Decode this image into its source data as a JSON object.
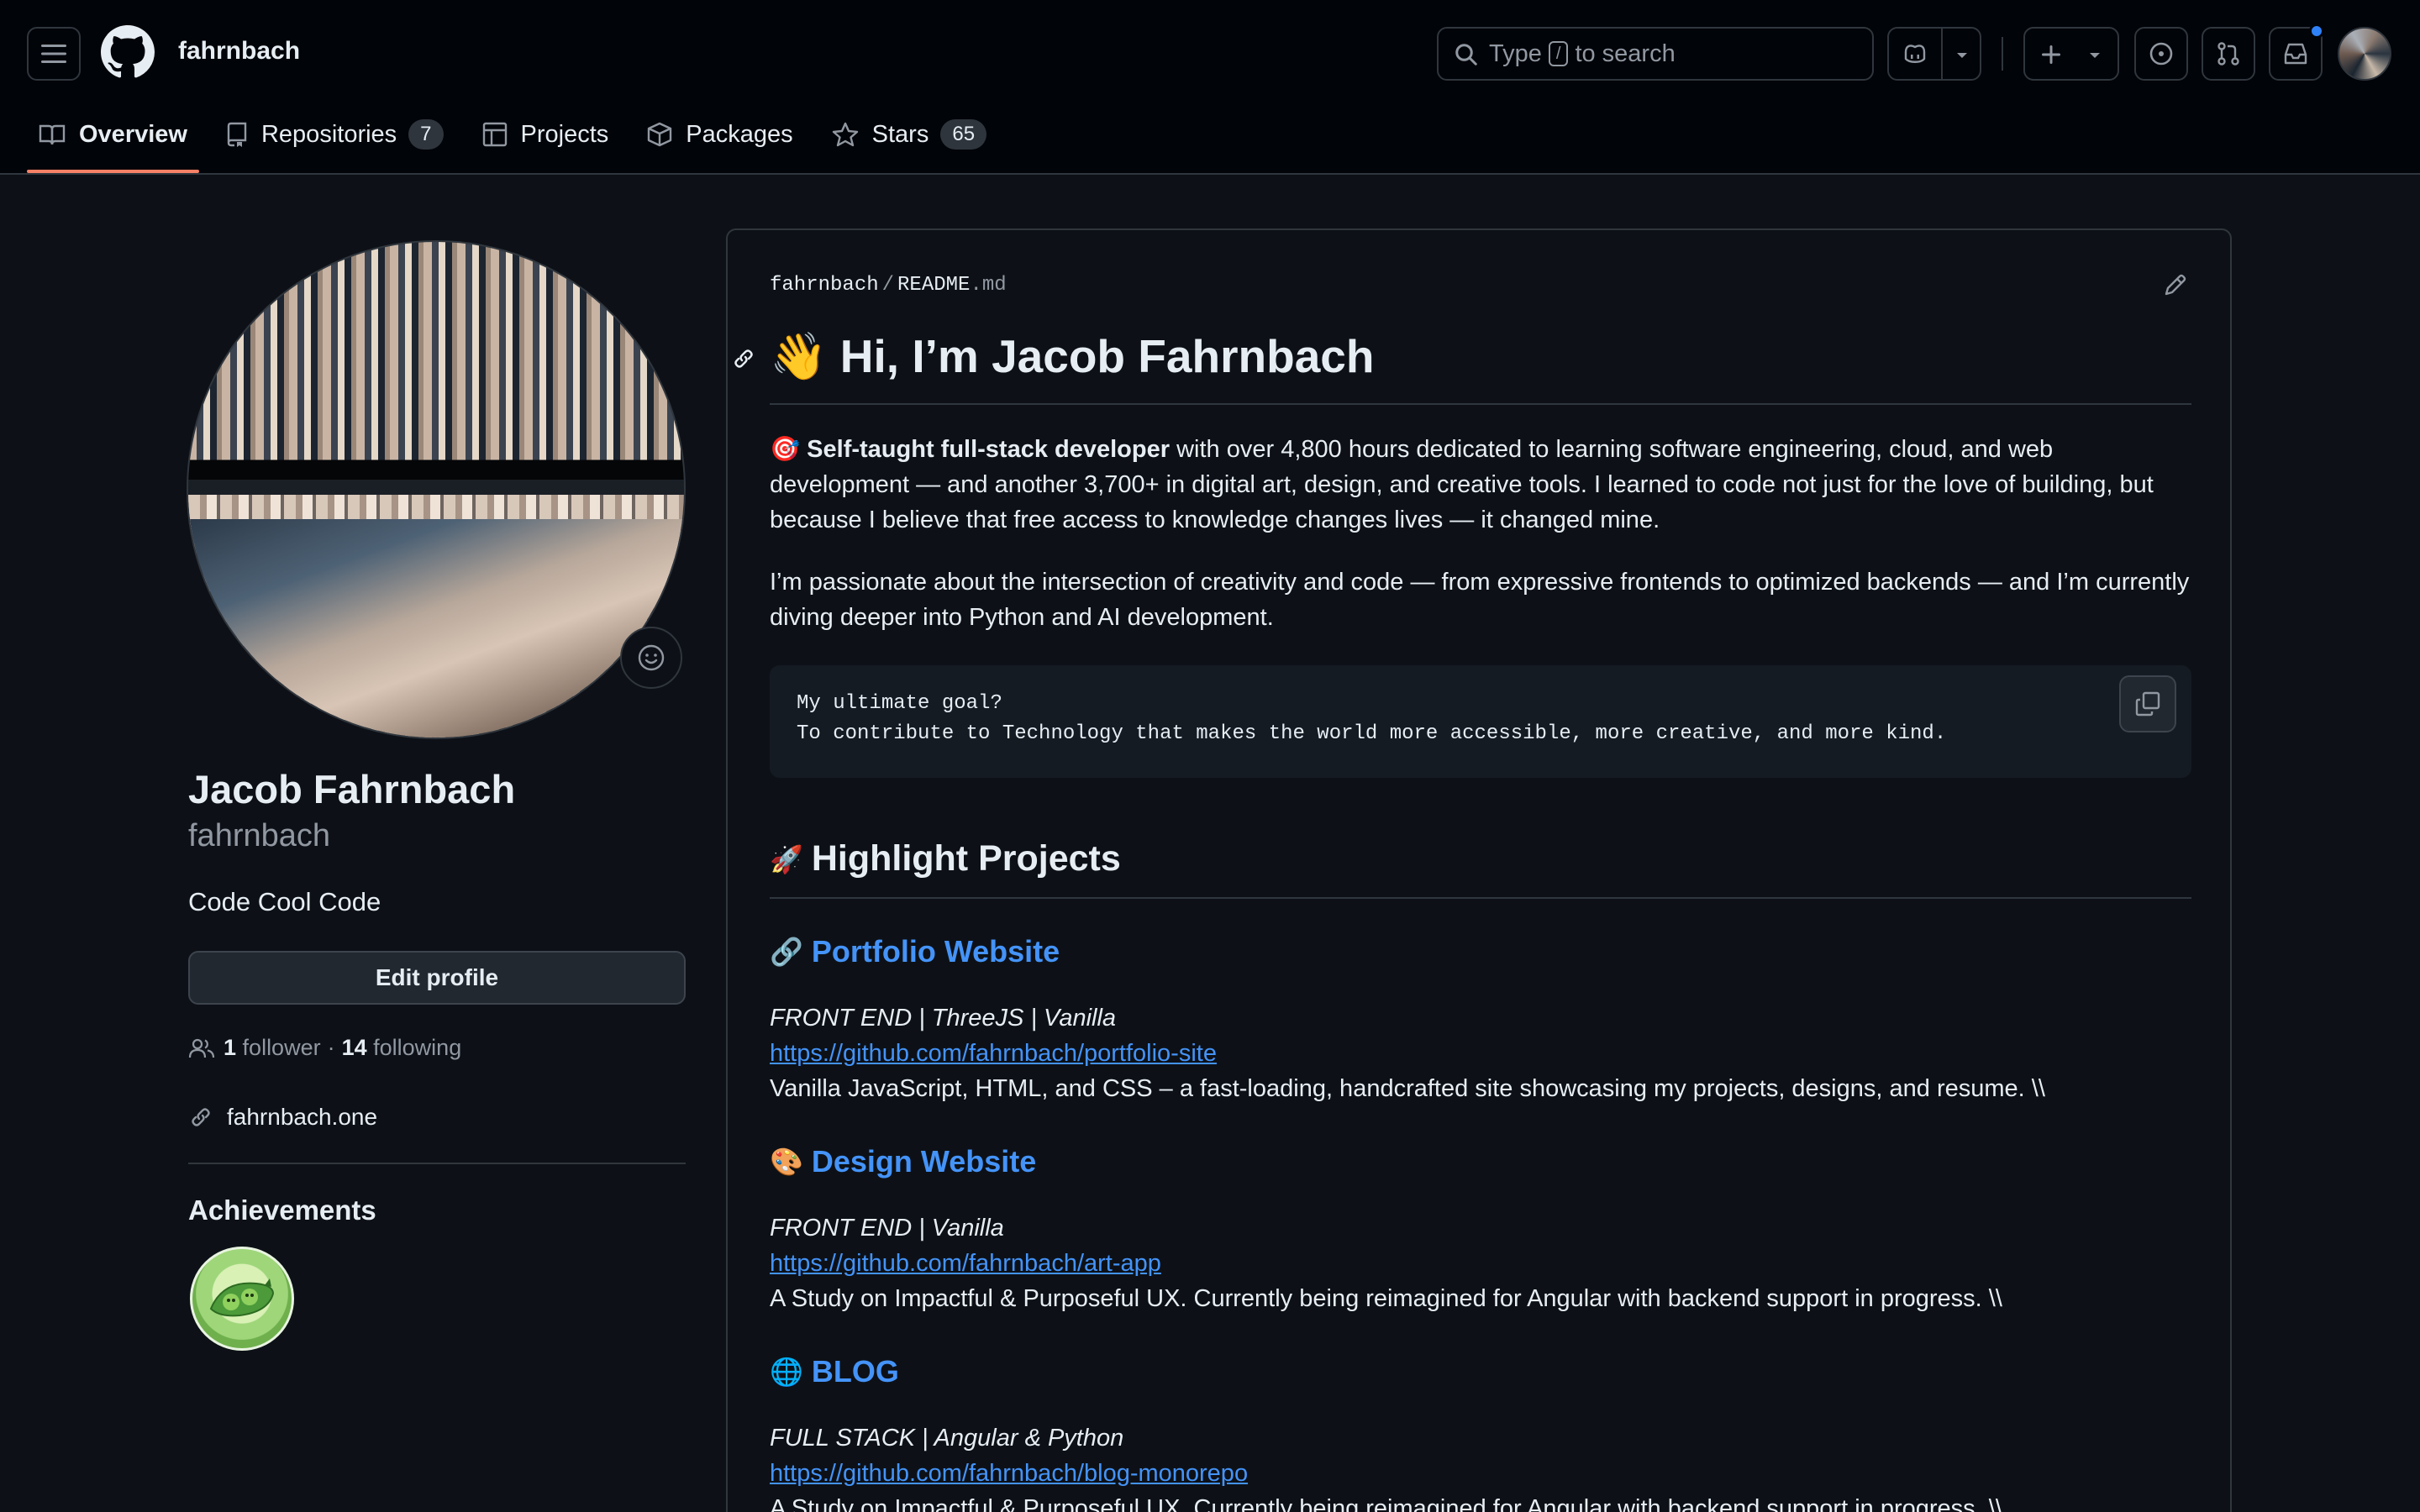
{
  "header": {
    "username": "fahrnbach",
    "search_prefix": "Type",
    "search_key": "/",
    "search_suffix": "to search"
  },
  "tabs": [
    {
      "label": "Overview",
      "count": ""
    },
    {
      "label": "Repositories",
      "count": "7"
    },
    {
      "label": "Projects",
      "count": ""
    },
    {
      "label": "Packages",
      "count": ""
    },
    {
      "label": "Stars",
      "count": "65"
    }
  ],
  "profile": {
    "name": "Jacob Fahrnbach",
    "login": "fahrnbach",
    "bio": "Code Cool Code",
    "edit_label": "Edit profile",
    "followers": "1",
    "followers_label": "follower",
    "following": "14",
    "following_label": "following",
    "dot": "·",
    "website": "fahrnbach.one",
    "achievements_title": "Achievements"
  },
  "readme": {
    "crumb_owner": "fahrnbach",
    "crumb_sep": "/",
    "crumb_file": "README",
    "crumb_ext": ".md",
    "title_emoji": "👋",
    "title": "Hi, I’m Jacob Fahrnbach",
    "p1_emoji": "🎯",
    "p1_bold": "Self-taught full-stack developer",
    "p1_rest": " with over 4,800 hours dedicated to learning software engineering, cloud, and web development — and another 3,700+ in digital art, design, and creative tools. I learned to code not just for the love of building, but because I believe that free access to knowledge changes lives — it changed mine.",
    "p2": "I’m passionate about the intersection of creativity and code — from expressive frontends to optimized backends — and I’m currently diving deeper into Python and AI development.",
    "code_line1": "My ultimate goal?",
    "code_line2": "To contribute to Technology that makes the world more accessible, more creative, and more kind.",
    "h2_emoji": "🚀",
    "h2": "Highlight Projects",
    "projects": [
      {
        "emoji": "🔗",
        "title": "Portfolio Website",
        "tech": "FRONT END | ThreeJS | Vanilla",
        "url": "https://github.com/fahrnbach/portfolio-site",
        "desc": "Vanilla JavaScript, HTML, and CSS – a fast-loading, handcrafted site showcasing my projects, designs, and resume. \\\\"
      },
      {
        "emoji": "🎨",
        "title": "Design Website",
        "tech": "FRONT END | Vanilla",
        "url": "https://github.com/fahrnbach/art-app",
        "desc": "A Study on Impactful & Purposeful UX. Currently being reimagined for Angular with backend support in progress. \\\\"
      },
      {
        "emoji": "🌐",
        "title": "BLOG",
        "tech": "FULL STACK | Angular & Python",
        "url": "https://github.com/fahrnbach/blog-monorepo",
        "desc": "A Study on Impactful & Purposeful UX. Currently being reimagined for Angular with backend support in progress. \\\\"
      }
    ]
  },
  "colors": {
    "bg": "#0d1117",
    "header_bg": "#010409",
    "accent": "#f78166",
    "link": "#4493f8",
    "notification": "#2f81f7"
  }
}
